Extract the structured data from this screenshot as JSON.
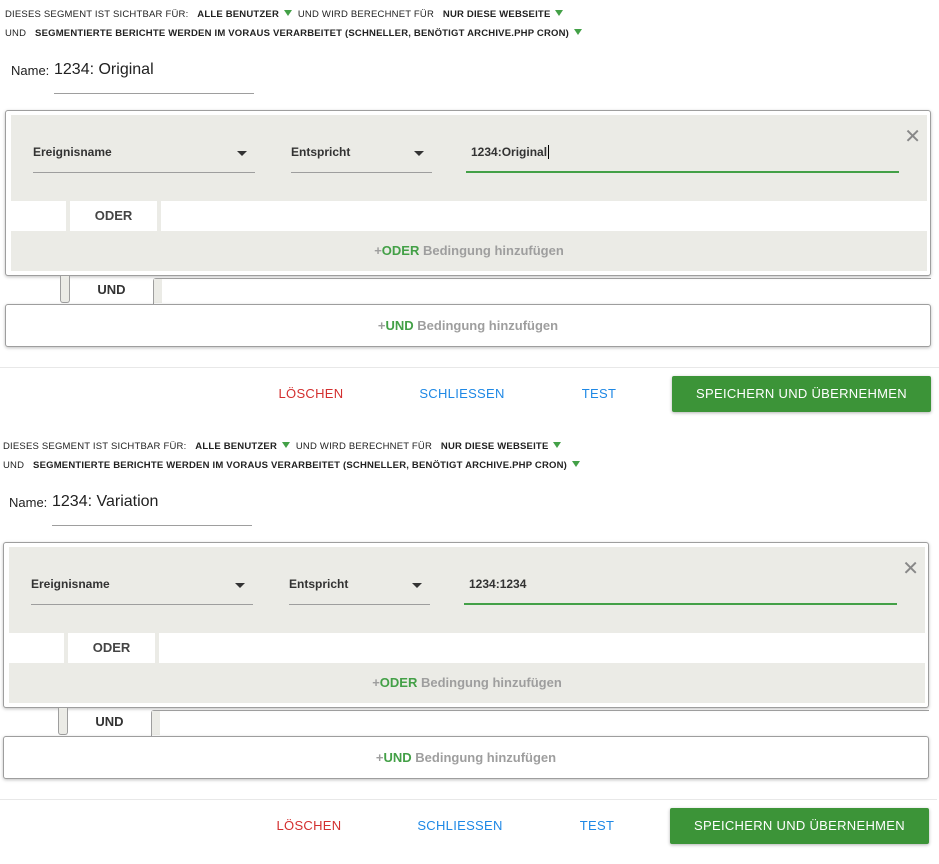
{
  "segments": [
    {
      "visibility_prefix": "DIESES SEGMENT IST SICHTBAR FÜR:",
      "visibility_value": "ALLE BENUTZER",
      "computed_prefix": "UND WIRD BERECHNET FÜR",
      "computed_value": "NUR DIESE WEBSEITE",
      "processing_prefix": "UND",
      "processing_value": "SEGMENTIERTE BERICHTE WERDEN IM VORAUS VERARBEITET (SCHNELLER, BENÖTIGT ARCHIVE.PHP CRON)",
      "name_label": "Name:",
      "name_value": "1234: Original",
      "condition": {
        "dimension": "Ereignisname",
        "operator": "Entspricht",
        "value": "1234:Original"
      },
      "or_label": "ODER",
      "add_or": {
        "plus": "+",
        "keyword": "ODER",
        "text": " Bedingung hinzufügen"
      },
      "and_label": "UND",
      "add_and": {
        "plus": "+",
        "keyword": "UND",
        "text": " Bedingung hinzufügen"
      },
      "buttons": {
        "delete": "LÖSCHEN",
        "close": "SCHLIESSEN",
        "test": "TEST",
        "save": "SPEICHERN UND ÜBERNEHMEN"
      }
    },
    {
      "visibility_prefix": "DIESES SEGMENT IST SICHTBAR FÜR:",
      "visibility_value": "ALLE BENUTZER",
      "computed_prefix": "UND WIRD BERECHNET FÜR",
      "computed_value": "NUR DIESE WEBSEITE",
      "processing_prefix": "UND",
      "processing_value": "SEGMENTIERTE BERICHTE WERDEN IM VORAUS VERARBEITET (SCHNELLER, BENÖTIGT ARCHIVE.PHP CRON)",
      "name_label": "Name:",
      "name_value": "1234: Variation",
      "condition": {
        "dimension": "Ereignisname",
        "operator": "Entspricht",
        "value": "1234:1234"
      },
      "or_label": "ODER",
      "add_or": {
        "plus": "+",
        "keyword": "ODER",
        "text": " Bedingung hinzufügen"
      },
      "and_label": "UND",
      "add_and": {
        "plus": "+",
        "keyword": "UND",
        "text": " Bedingung hinzufügen"
      },
      "buttons": {
        "delete": "LÖSCHEN",
        "close": "SCHLIESSEN",
        "test": "TEST",
        "save": "SPEICHERN UND ÜBERNEHMEN"
      }
    }
  ],
  "colors": {
    "accent_green": "#43a047",
    "save_button": "#3c9438",
    "delete_red": "#d32f2f",
    "link_blue": "#1e88e5",
    "condition_bg": "#ebebe6"
  },
  "icons": {
    "dropdown": "caret-down-icon",
    "remove": "close-icon"
  }
}
